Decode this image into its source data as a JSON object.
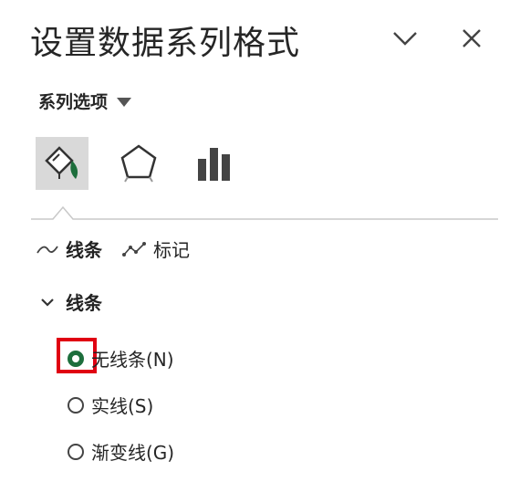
{
  "pane": {
    "title": "设置数据系列格式"
  },
  "header": {
    "collapse_icon": "chevron-down-icon",
    "close_icon": "close-icon"
  },
  "series_options": {
    "label": "系列选项"
  },
  "icon_tabs": [
    {
      "name": "fill-line",
      "icon": "paint-bucket-icon",
      "active": true
    },
    {
      "name": "effects",
      "icon": "pentagon-icon",
      "active": false
    },
    {
      "name": "series-options",
      "icon": "bar-chart-icon",
      "active": false
    }
  ],
  "subtabs": {
    "line": "线条",
    "marker": "标记"
  },
  "section": {
    "title": "线条"
  },
  "radios": [
    {
      "label": "无线条(N)",
      "checked": true
    },
    {
      "label": "实线(S)",
      "checked": false
    },
    {
      "label": "渐变线(G)",
      "checked": false
    }
  ],
  "colors": {
    "accent": "#1d6e3c",
    "highlight": "#e00012"
  }
}
